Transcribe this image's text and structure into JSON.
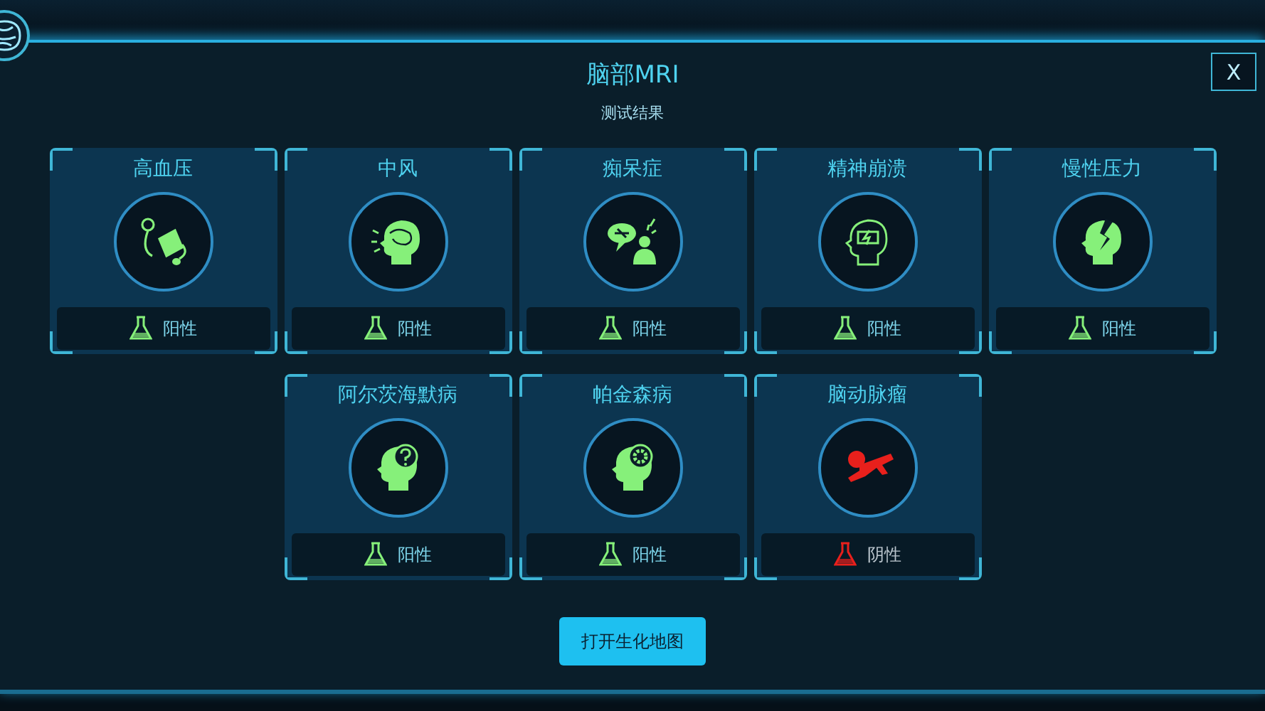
{
  "header": {
    "title": "脑部MRI",
    "subtitle": "测试结果",
    "close_label": "X"
  },
  "card_rows": [
    [
      {
        "name": "高血压",
        "result": {
          "label": "阳性",
          "kind": "positive"
        }
      },
      {
        "name": "中风",
        "result": {
          "label": "阳性",
          "kind": "positive"
        }
      },
      {
        "name": "痴呆症",
        "result": {
          "label": "阳性",
          "kind": "positive"
        }
      },
      {
        "name": "精神崩溃",
        "result": {
          "label": "阳性",
          "kind": "positive"
        }
      },
      {
        "name": "慢性压力",
        "result": {
          "label": "阳性",
          "kind": "positive"
        }
      }
    ],
    [
      {
        "name": "阿尔茨海默病",
        "result": {
          "label": "阳性",
          "kind": "positive"
        }
      },
      {
        "name": "帕金森病",
        "result": {
          "label": "阳性",
          "kind": "positive"
        }
      },
      {
        "name": "脑动脉瘤",
        "result": {
          "label": "阴性",
          "kind": "negative"
        }
      }
    ]
  ],
  "action_button": "打开生化地图"
}
